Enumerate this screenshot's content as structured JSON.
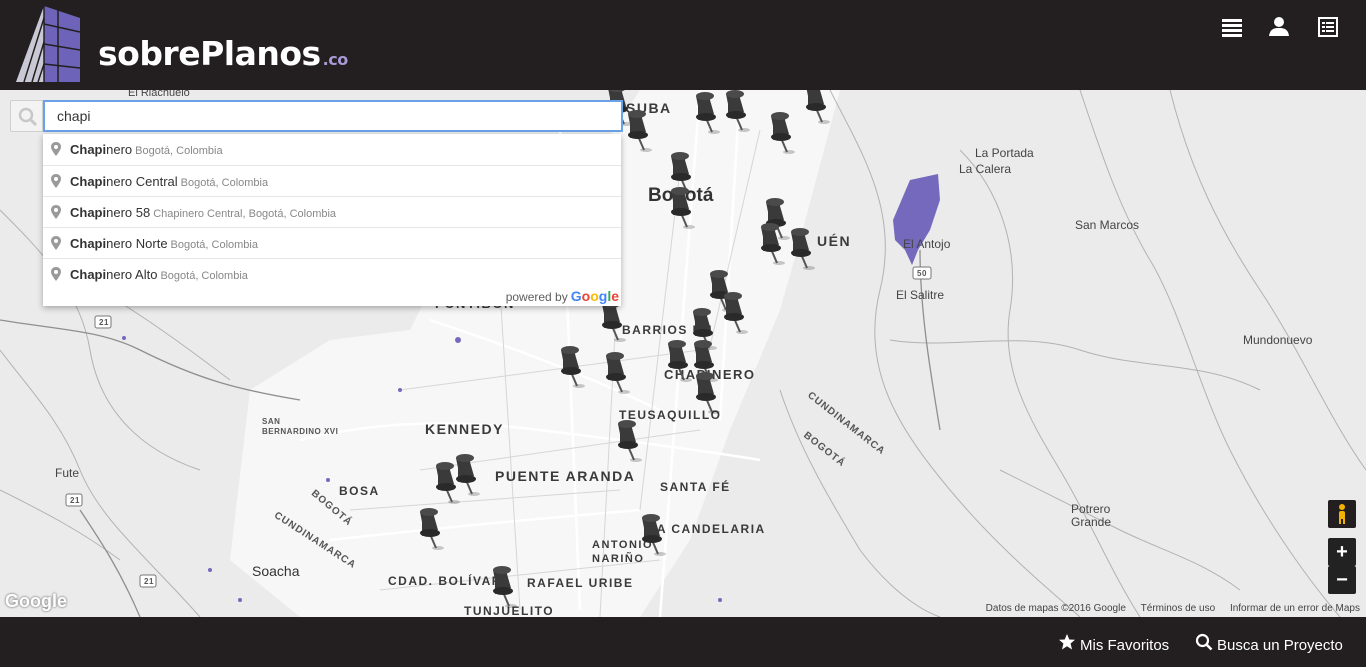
{
  "header": {
    "logo_text": "sobrePlanos",
    "logo_tld": ".co",
    "menu_icon": "list-icon",
    "user_icon": "user-icon",
    "doc_icon": "document-icon"
  },
  "search": {
    "value": "chapi",
    "icon": "search-icon",
    "suggestions": [
      {
        "match": "Chapi",
        "rest": "nero",
        "secondary": "Bogotá, Colombia"
      },
      {
        "match": "Chapi",
        "rest": "nero Central",
        "secondary": "Bogotá, Colombia"
      },
      {
        "match": "Chapi",
        "rest": "nero 58",
        "secondary": "Chapinero Central, Bogotá, Colombia"
      },
      {
        "match": "Chapi",
        "rest": "nero Norte",
        "secondary": "Bogotá, Colombia"
      },
      {
        "match": "Chapi",
        "rest": "nero Alto",
        "secondary": "Bogotá, Colombia"
      }
    ],
    "powered_by": "powered by",
    "powered_brand": "Google"
  },
  "map": {
    "labels": {
      "suba": "SUBA",
      "bogota": "Bogotá",
      "usaquen": "UÉN",
      "fontibon": "FONTIBÓN",
      "barrios_unidos": "BARRIOS UN",
      "chapinero": "CHAPINERO",
      "teusaquillo": "TEUSAQUILLO",
      "kennedy": "KENNEDY",
      "puente_aranda": "PUENTE ARANDA",
      "santa_fe": "SANTA FÉ",
      "candelaria": "LA CANDELARIA",
      "antonio_narino": "ANTONIO NARIÑO",
      "bosa": "BOSA",
      "cdad_bolivar": "CDAD. BOLÍVAR",
      "rafael_uribe": "RAFAEL URIBE",
      "tunjuelito": "TUNJUELITO",
      "soacha": "Soacha",
      "fute": "Fute",
      "san_bernardino": "SAN BERNARDINO XVI",
      "el_riachuelo": "El Riachuelo",
      "la_portada": "La Portada",
      "la_calera": "La Calera",
      "el_antojo": "El Antojo",
      "san_marcos": "San Marcos",
      "el_salitre": "El Salitre",
      "mundonuevo": "Mundonuevo",
      "potrero_grande": "Potrero Grande",
      "cundinamarca_e": "CUNDINAMARCA",
      "bogota_e": "BOGOTÁ",
      "bogota_w": "BOGOTÁ",
      "cundinamarca_w": "CUNDINAMARCA",
      "route_50": "50",
      "route_21a": "21",
      "route_21b": "21",
      "route_21c": "21"
    },
    "zoom_in": "+",
    "zoom_out": "−",
    "pegman_icon": "pegman-icon",
    "google_logo": "Google",
    "attribution": {
      "data": "Datos de mapas ©2016 Google",
      "terms": "Términos de uso",
      "report": "Informar de un error de Maps"
    }
  },
  "footer": {
    "favorites": "Mis Favoritos",
    "search_project": "Busca un Proyecto"
  }
}
